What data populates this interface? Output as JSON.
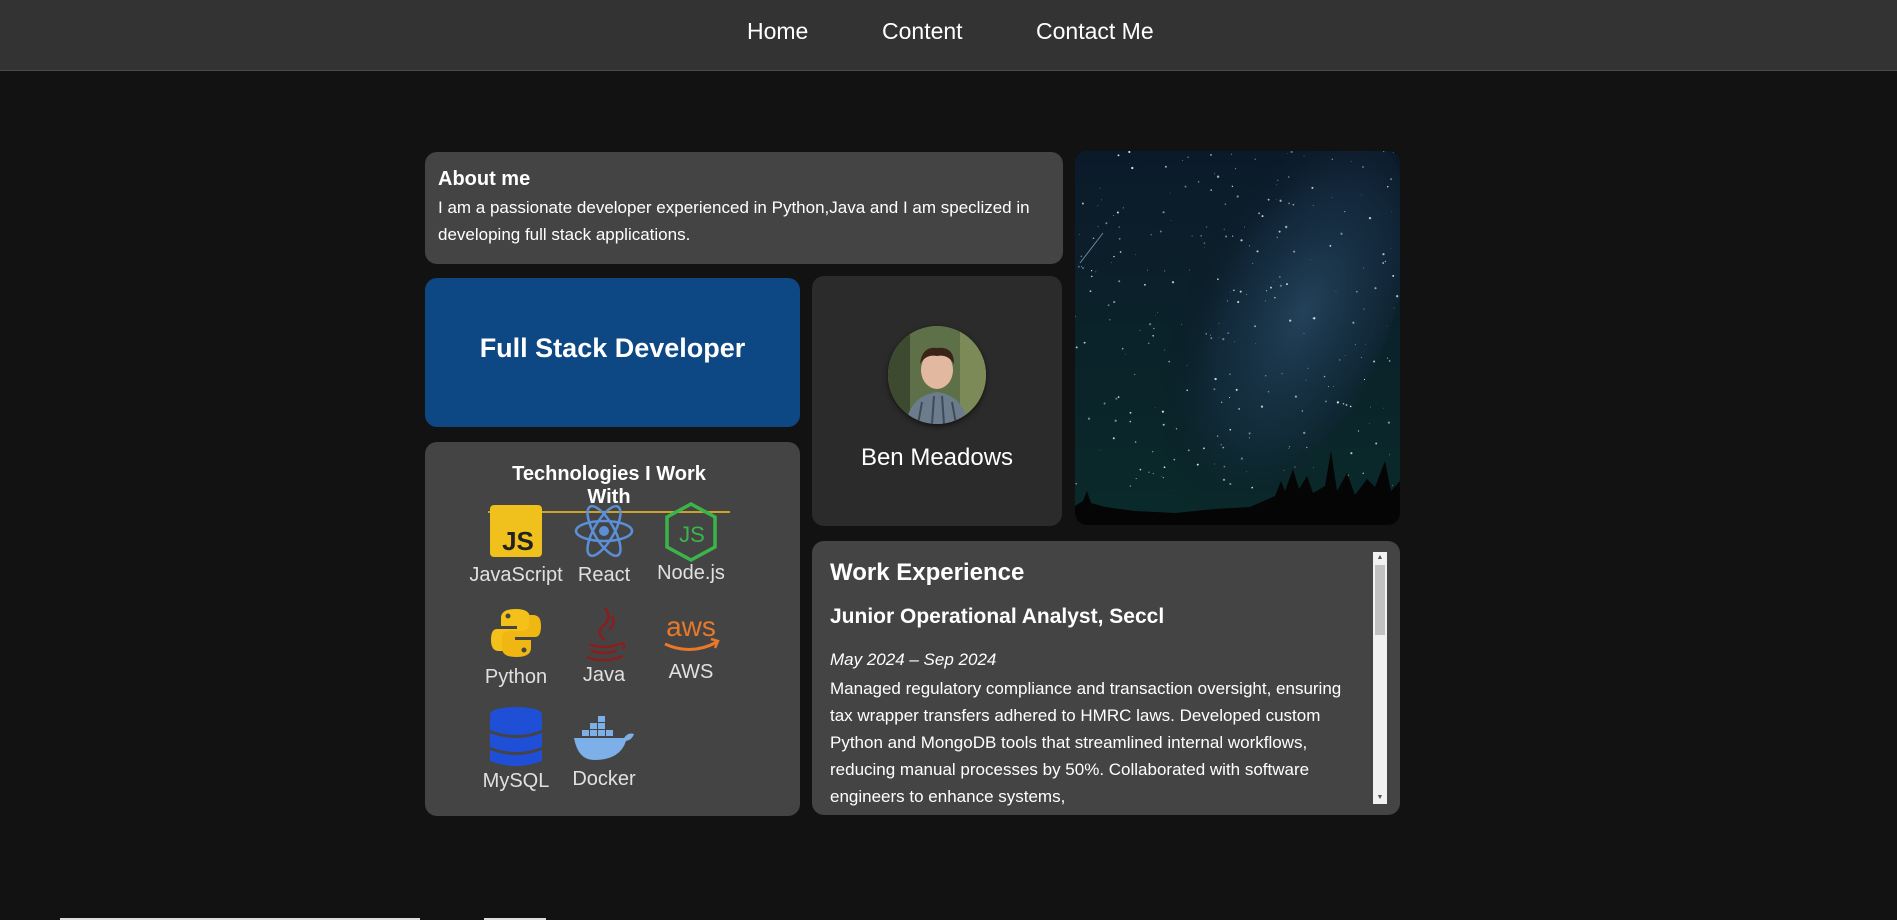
{
  "nav": {
    "items": [
      {
        "label": "Home"
      },
      {
        "label": "Content"
      },
      {
        "label": "Contact Me"
      }
    ]
  },
  "about": {
    "title": "About me",
    "text": "I am a passionate developer experienced in Python,Java and I am speclized in developing full stack applications."
  },
  "role": {
    "title": "Full Stack Developer"
  },
  "profile": {
    "name": "Ben Meadows"
  },
  "technologies": {
    "title": "Technologies I Work With",
    "items": [
      {
        "label": "JavaScript",
        "icon": "javascript-icon"
      },
      {
        "label": "React",
        "icon": "react-icon"
      },
      {
        "label": "Node.js",
        "icon": "nodejs-icon"
      },
      {
        "label": "Python",
        "icon": "python-icon"
      },
      {
        "label": "Java",
        "icon": "java-icon"
      },
      {
        "label": "AWS",
        "icon": "aws-icon"
      },
      {
        "label": "MySQL",
        "icon": "mysql-icon"
      },
      {
        "label": "Docker",
        "icon": "docker-icon"
      }
    ]
  },
  "work": {
    "title": "Work Experience",
    "jobs": [
      {
        "position": "Junior Operational Analyst, Seccl",
        "dates": "May 2024 – Sep 2024",
        "description": "Managed regulatory compliance and transaction oversight, ensuring tax wrapper transfers adhered to HMRC laws. Developed custom Python and MongoDB tools that streamlined internal workflows, reducing manual processes by 50%. Collaborated with software engineers to enhance systems,"
      }
    ]
  },
  "colors": {
    "page_bg": "#121212",
    "nav_bg": "#333333",
    "card_bg": "#444444",
    "role_card_bg": "#0d4784",
    "profile_card_bg": "#2b2b2b",
    "accent_underline": "#c9a227"
  }
}
